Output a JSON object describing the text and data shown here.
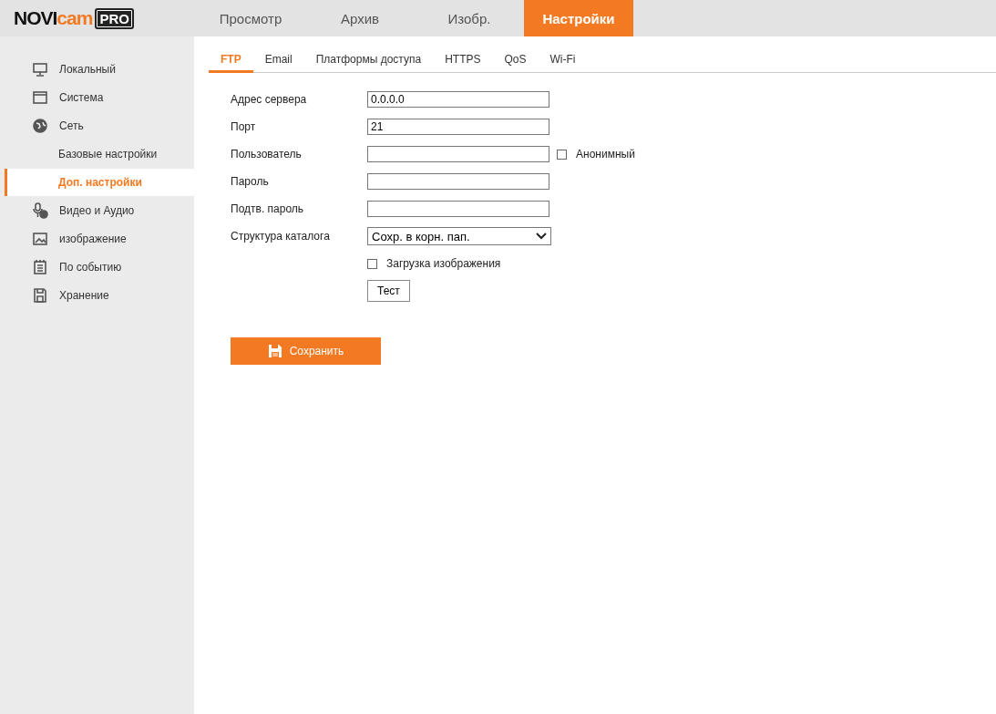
{
  "logo": {
    "name": "NOVI",
    "accent": "cam",
    "badge": "PRO"
  },
  "nav": [
    {
      "label": "Просмотр",
      "selected": false
    },
    {
      "label": "Архив",
      "selected": false
    },
    {
      "label": "Изобр.",
      "selected": false
    },
    {
      "label": "Настройки",
      "selected": true
    }
  ],
  "sidebar": {
    "items": [
      {
        "label": "Локальный",
        "kind": "section",
        "selected": false
      },
      {
        "label": "Система",
        "kind": "section",
        "selected": false
      },
      {
        "label": "Сеть",
        "kind": "section",
        "selected": false,
        "children": [
          {
            "label": "Базовые настройки",
            "selected": false
          },
          {
            "label": "Доп. настройки",
            "selected": true
          }
        ]
      },
      {
        "label": "Видео и Аудио",
        "kind": "section",
        "selected": false
      },
      {
        "label": "изображение",
        "kind": "section",
        "selected": false
      },
      {
        "label": "По событию",
        "kind": "section",
        "selected": false
      },
      {
        "label": "Хранение",
        "kind": "section",
        "selected": false
      }
    ]
  },
  "tabs": [
    {
      "label": "FTP",
      "selected": true
    },
    {
      "label": "Email",
      "selected": false
    },
    {
      "label": "Платформы доступа",
      "selected": false
    },
    {
      "label": "HTTPS",
      "selected": false
    },
    {
      "label": "QoS",
      "selected": false
    },
    {
      "label": "Wi-Fi",
      "selected": false
    }
  ],
  "form": [
    {
      "kind": "text",
      "label": "Адрес сервера",
      "value": "0.0.0.0"
    },
    {
      "kind": "text",
      "label": "Порт",
      "value": "21"
    },
    {
      "kind": "text",
      "label": "Пользователь",
      "extra": {
        "label": "Анонимный",
        "checked": false
      }
    },
    {
      "kind": "text",
      "label": "Пароль"
    },
    {
      "kind": "text",
      "label": "Подтв. пароль"
    },
    {
      "kind": "select",
      "label": "Структура каталога",
      "value": "Сохр. в корн. пап."
    },
    {
      "kind": "checkbox",
      "label": "Загрузка изображения",
      "checked": false
    },
    {
      "kind": "button",
      "label": "Тест"
    }
  ],
  "save_button": "Сохранить"
}
